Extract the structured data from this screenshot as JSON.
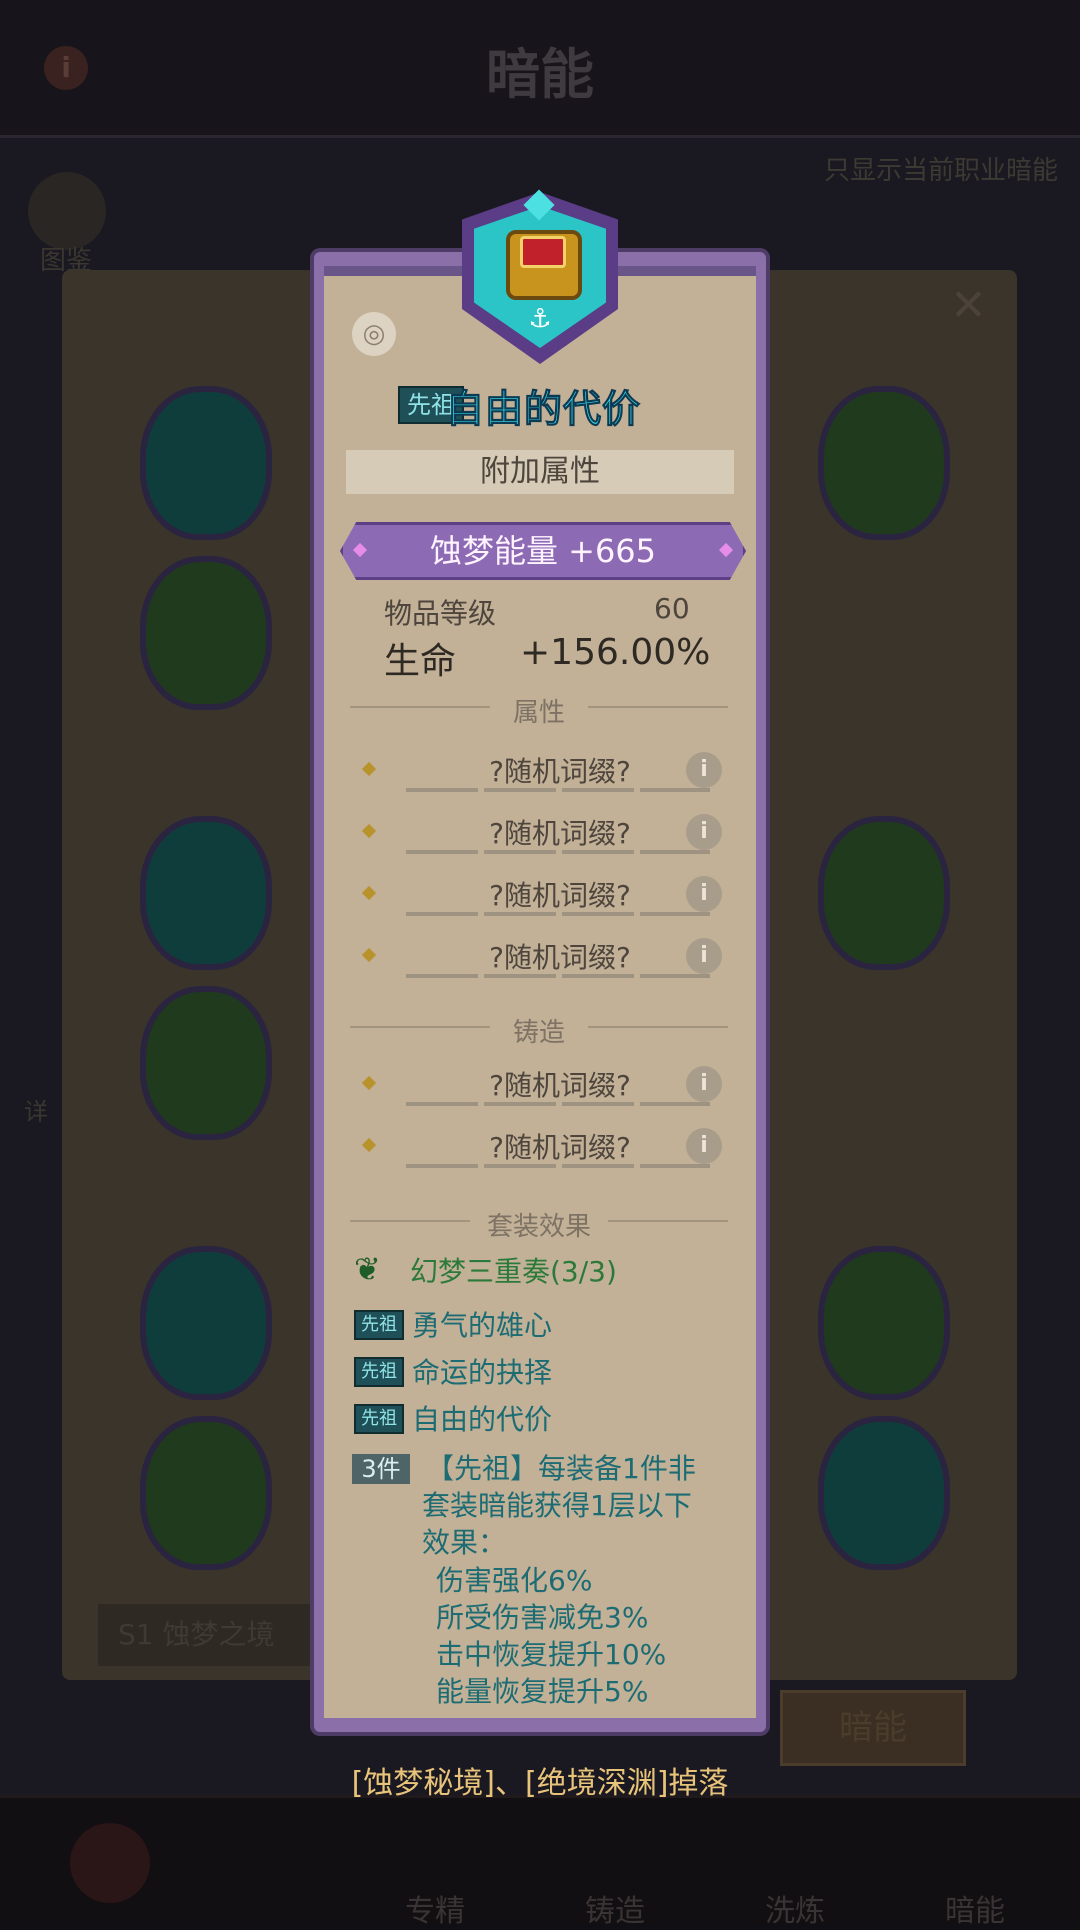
{
  "background": {
    "screen_title": "暗能",
    "filter_text": "只显示当前职业暗能",
    "book_label": "图鉴",
    "detail_label": "详",
    "season_label": "S1 蚀梦之境",
    "tab_label": "暗能",
    "nav": [
      "专精",
      "铸造",
      "洗炼",
      "暗能"
    ]
  },
  "item": {
    "rarity": "先祖",
    "name": "自由的代价",
    "attr_header": "附加属性",
    "energy": "蚀梦能量  +665",
    "level_label": "物品等级",
    "level_value": "60",
    "hp_label": "生命",
    "hp_value": "+156.00%"
  },
  "sections": {
    "attributes": "属性",
    "forge": "铸造",
    "set": "套装效果"
  },
  "affixes": [
    "?随机词缀?",
    "?随机词缀?",
    "?随机词缀?",
    "?随机词缀?"
  ],
  "forge_affixes": [
    "?随机词缀?",
    "?随机词缀?"
  ],
  "set": {
    "name": "幻梦三重奏(3/3)",
    "pieces": [
      {
        "tag": "先祖",
        "name": "勇气的雄心"
      },
      {
        "tag": "先祖",
        "name": "命运的抉择"
      },
      {
        "tag": "先祖",
        "name": "自由的代价"
      }
    ],
    "count_tag": "3件",
    "bonus_lines": [
      "【先祖】每装备1件非",
      "套装暗能获得1层以下",
      "效果：",
      "伤害强化6%",
      "所受伤害减免3%",
      "击中恢复提升10%",
      "能量恢复提升5%"
    ]
  },
  "drop_source": "[蚀梦秘境]、[绝境深渊]掉落",
  "colors": {
    "name_cyan": "#3ae5f0",
    "energy_purple": "#8c6ab4",
    "paper": "#c2b197",
    "set_teal": "#1d6c73",
    "drop_gold": "#e8c37a"
  }
}
